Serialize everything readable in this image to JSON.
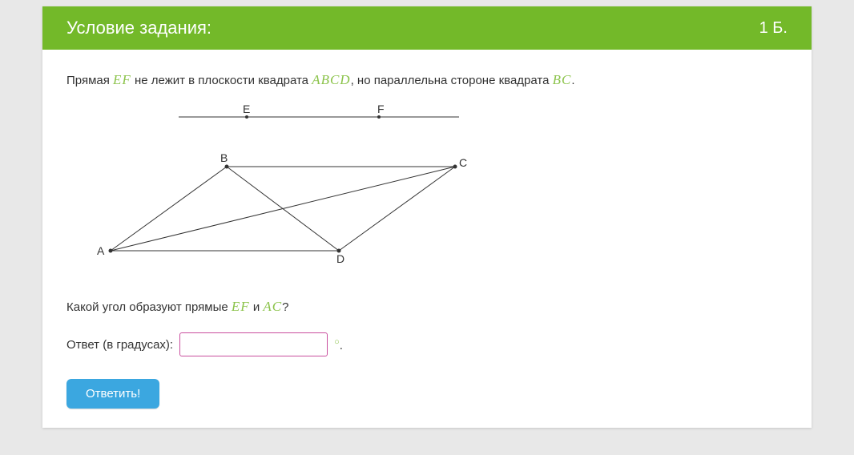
{
  "header": {
    "title": "Условие задания:",
    "score": "1 Б."
  },
  "problem": {
    "line1_parts": {
      "p1": "Прямая ",
      "m1": "EF",
      "p2": " не лежит в плоскости квадрата ",
      "m2": "ABCD",
      "p3": ", но параллельна стороне квадрата ",
      "m3": "BC",
      "p4": "."
    },
    "question_parts": {
      "q1": "Какой угол образуют прямые ",
      "m1": "EF",
      "q2": " и ",
      "m2": "AC",
      "q3": "?"
    }
  },
  "answer": {
    "label": "Ответ (в градусах):",
    "value": "",
    "unit_suffix": "."
  },
  "submit": {
    "label": "Ответить!"
  },
  "diagram": {
    "labels": {
      "E": "E",
      "F": "F",
      "A": "A",
      "B": "B",
      "C": "C",
      "D": "D"
    }
  }
}
